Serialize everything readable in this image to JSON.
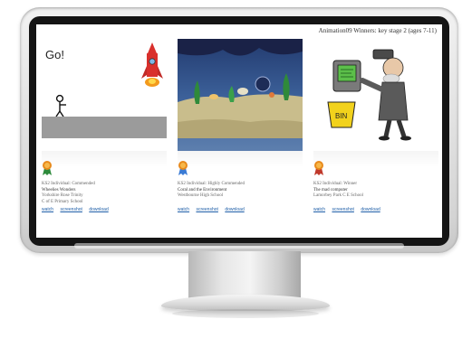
{
  "screen": {
    "header": "Animation09 Winners: key stage 2 (ages 7-11)"
  },
  "cards": [
    {
      "drawing_text": "Go!",
      "award_line": "KS2 Individual: Commended",
      "title": "Wheelies Wonders",
      "author": "Yorkshire Rose Trinity",
      "school": "C of E Primary School",
      "links": [
        "watch",
        "screenshot",
        "download"
      ]
    },
    {
      "award_line": "KS2 Individual: Highly Commended",
      "title": "Coral and the Environment",
      "author": "Westbourne High School",
      "school": "",
      "links": [
        "watch",
        "screenshot",
        "download"
      ]
    },
    {
      "box_text": "BIN",
      "award_line": "KS2 Individual: Winner",
      "title": "The mad computer",
      "author": "Lamorbey Park C E School",
      "school": "",
      "links": [
        "watch",
        "screenshot",
        "download"
      ]
    }
  ],
  "colors": {
    "link": "#1f5fa8",
    "rocket": "#d9302c",
    "undersea": "#223a6e"
  }
}
